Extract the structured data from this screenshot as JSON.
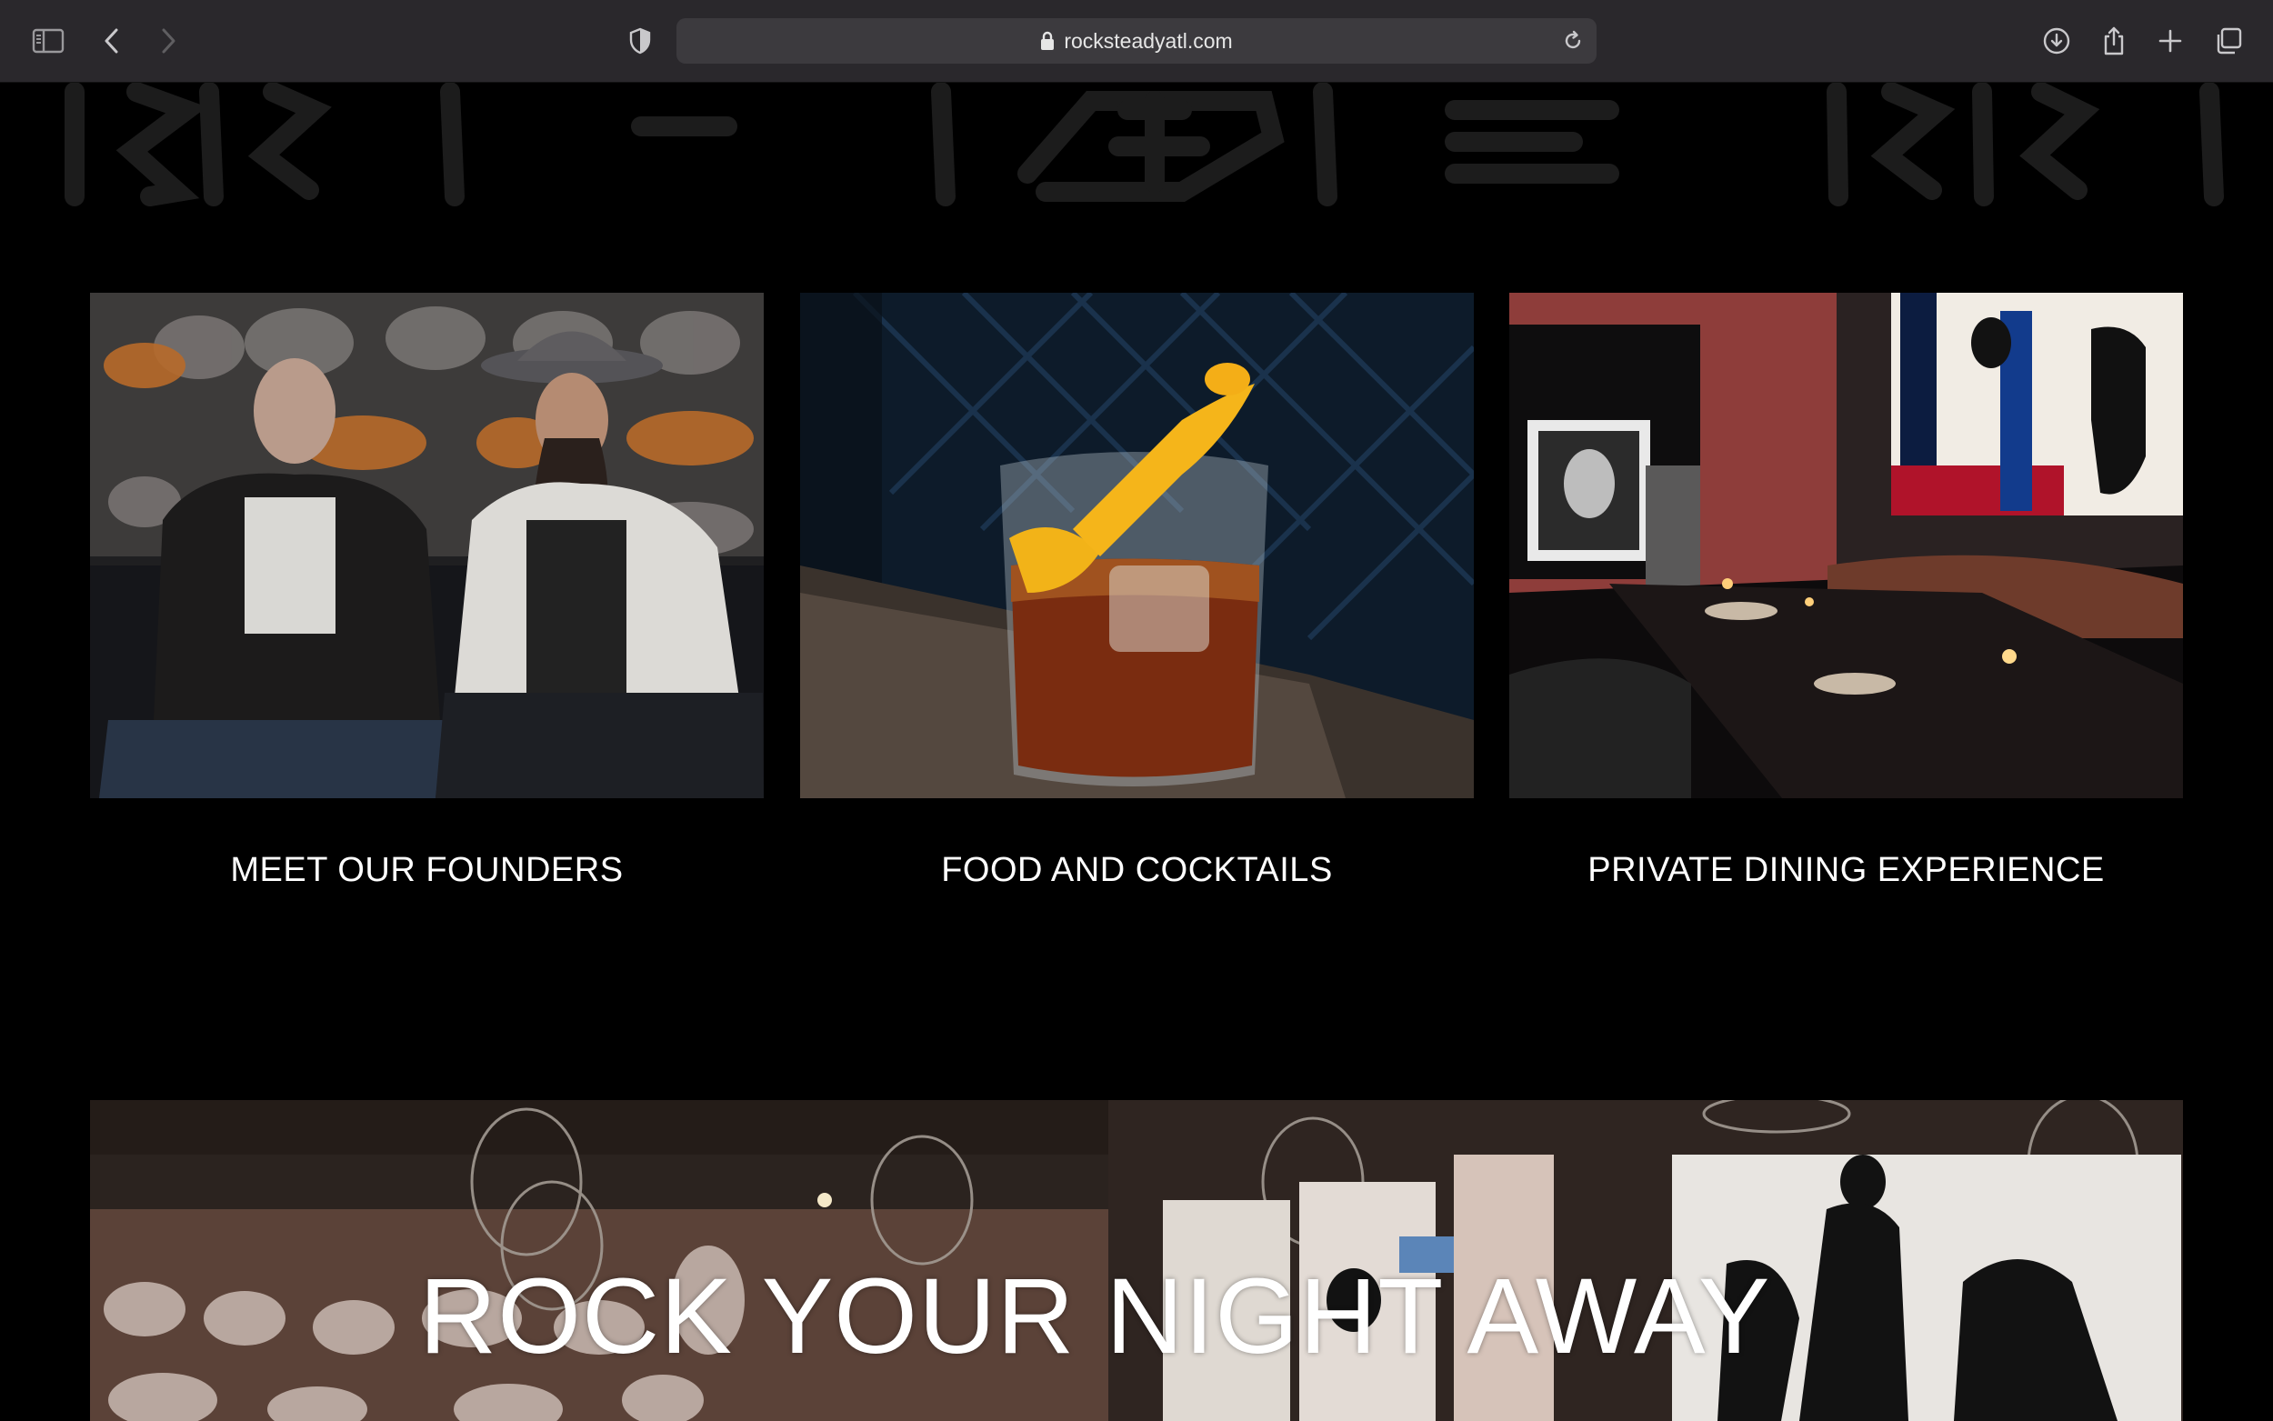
{
  "browser": {
    "url": "rocksteadyatl.com",
    "icons": {
      "sidebar": "sidebar-icon",
      "back": "chevron-left-icon",
      "forward": "chevron-right-icon",
      "privacy": "shield-icon",
      "lock": "lock-icon",
      "reload": "reload-icon",
      "download": "download-icon",
      "share": "share-icon",
      "new_tab": "plus-icon",
      "tabs": "tab-overview-icon"
    }
  },
  "cards": [
    {
      "caption": "MEET OUR FOUNDERS",
      "image": "two founders seated"
    },
    {
      "caption": "FOOD AND COCKTAILS",
      "image": "cocktail with orange peel"
    },
    {
      "caption": "PRIVATE DINING EXPERIENCE",
      "image": "private dining room"
    }
  ],
  "banner": {
    "headline": "ROCK YOUR NIGHT AWAY"
  },
  "colors": {
    "background": "#000000",
    "chrome": "#2a282c",
    "urlbar": "#3c3a3e",
    "text": "#ffffff"
  }
}
